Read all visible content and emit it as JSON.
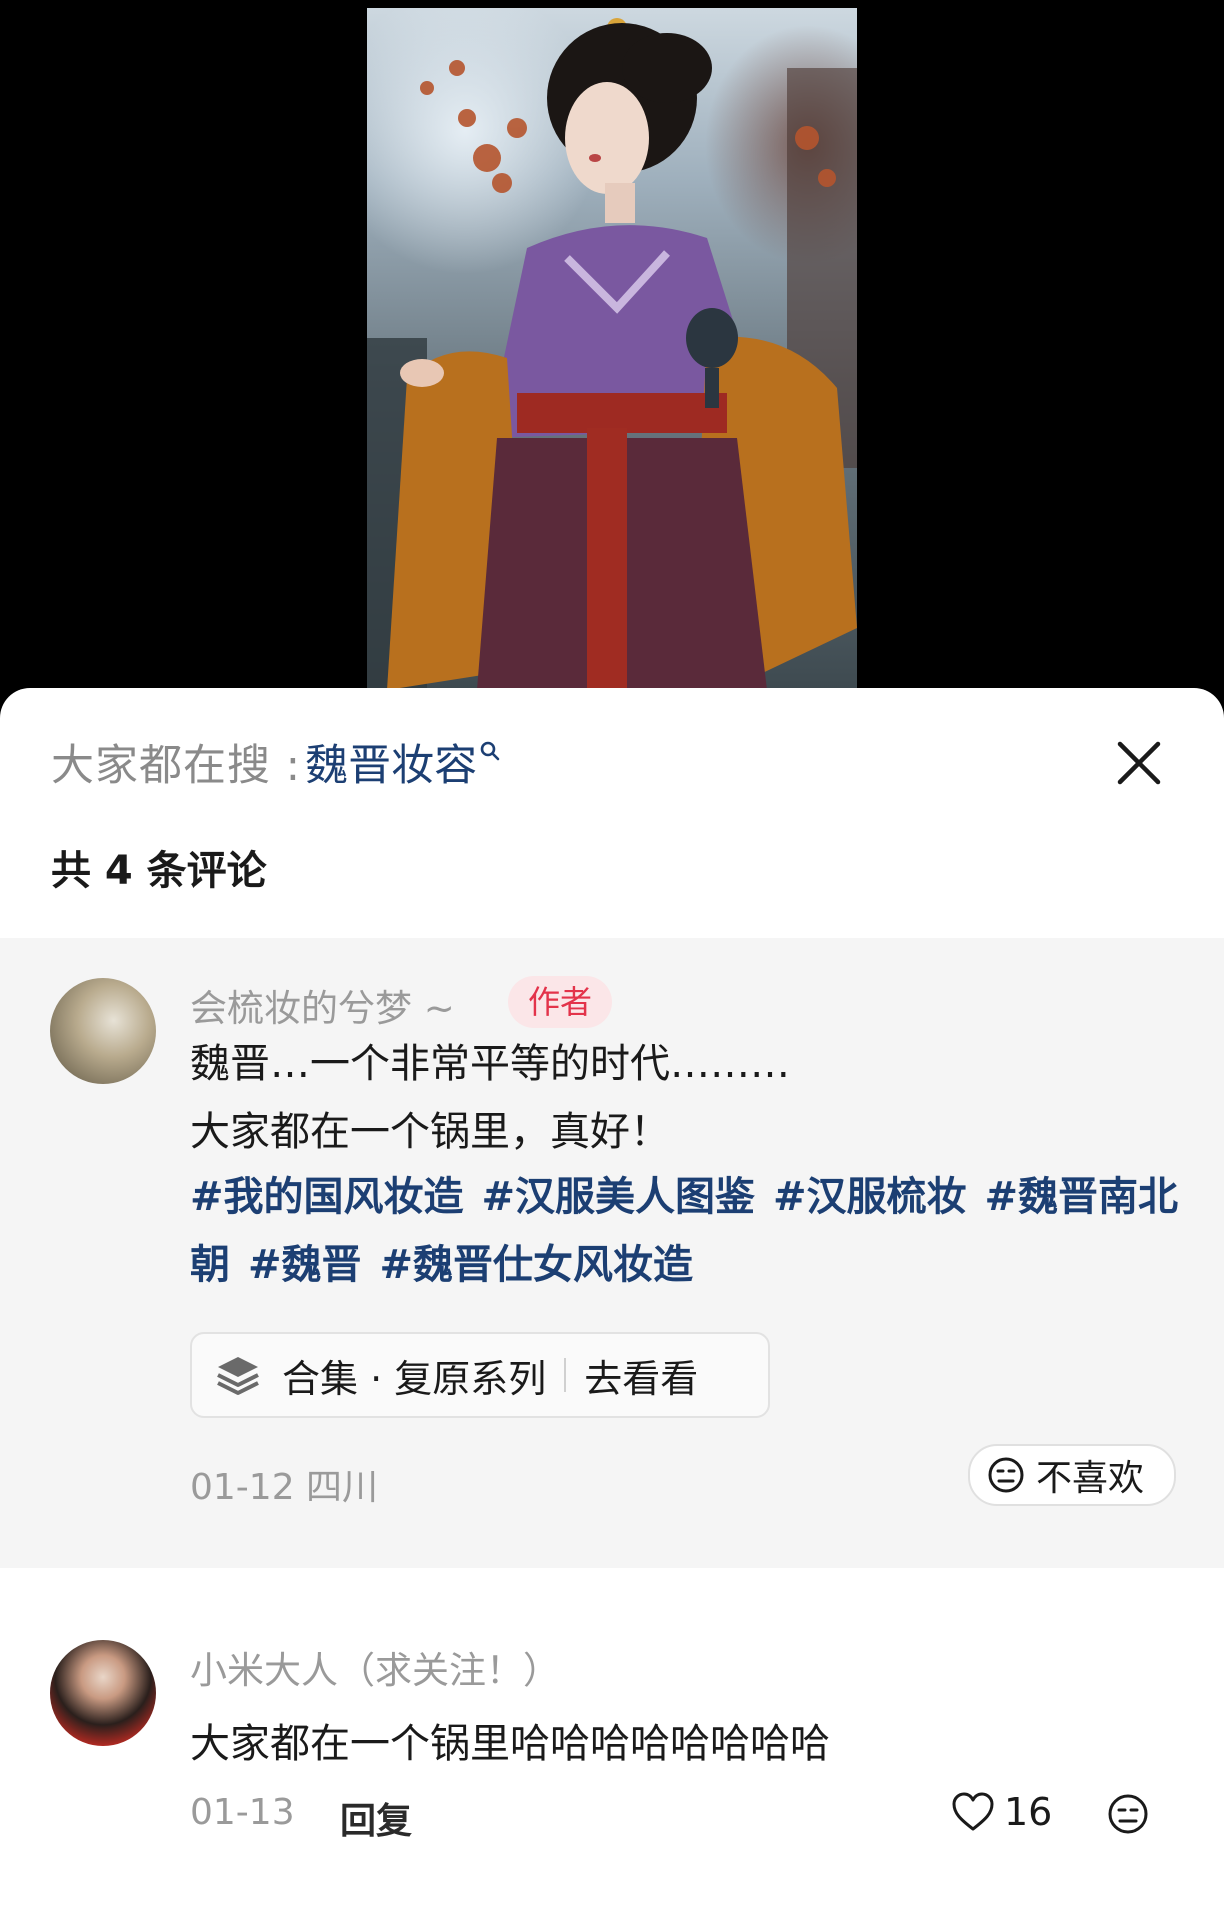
{
  "search": {
    "prefix": "大家都在搜 : ",
    "term": "魏晋妆容"
  },
  "comment_count": "共 4 条评论",
  "author_comment": {
    "name": "会梳妆的兮梦 ~",
    "badge": "作者",
    "line1": "魏晋…一个非常平等的时代………",
    "line2": "大家都在一个锅里，真好！",
    "hashtags": [
      "#我的国风妆造",
      "#汉服美人图鉴",
      "#汉服梳妆",
      "#魏晋南北朝",
      "#魏晋",
      "#魏晋仕女风妆造"
    ],
    "collection_label": "合集 · 复原系列",
    "collection_action": "去看看",
    "meta": "01-12 四川",
    "dislike_label": "不喜欢"
  },
  "comment2": {
    "name": "小米大人（求关注！）",
    "text": "大家都在一个锅里哈哈哈哈哈哈哈哈",
    "date": "01-13",
    "reply_label": "回复",
    "like_count": "16"
  },
  "colors": {
    "link_blue": "#1c3f73",
    "badge_red": "#e3334a",
    "badge_bg": "#fbe6e8",
    "muted_gray": "#9a9a9a"
  }
}
